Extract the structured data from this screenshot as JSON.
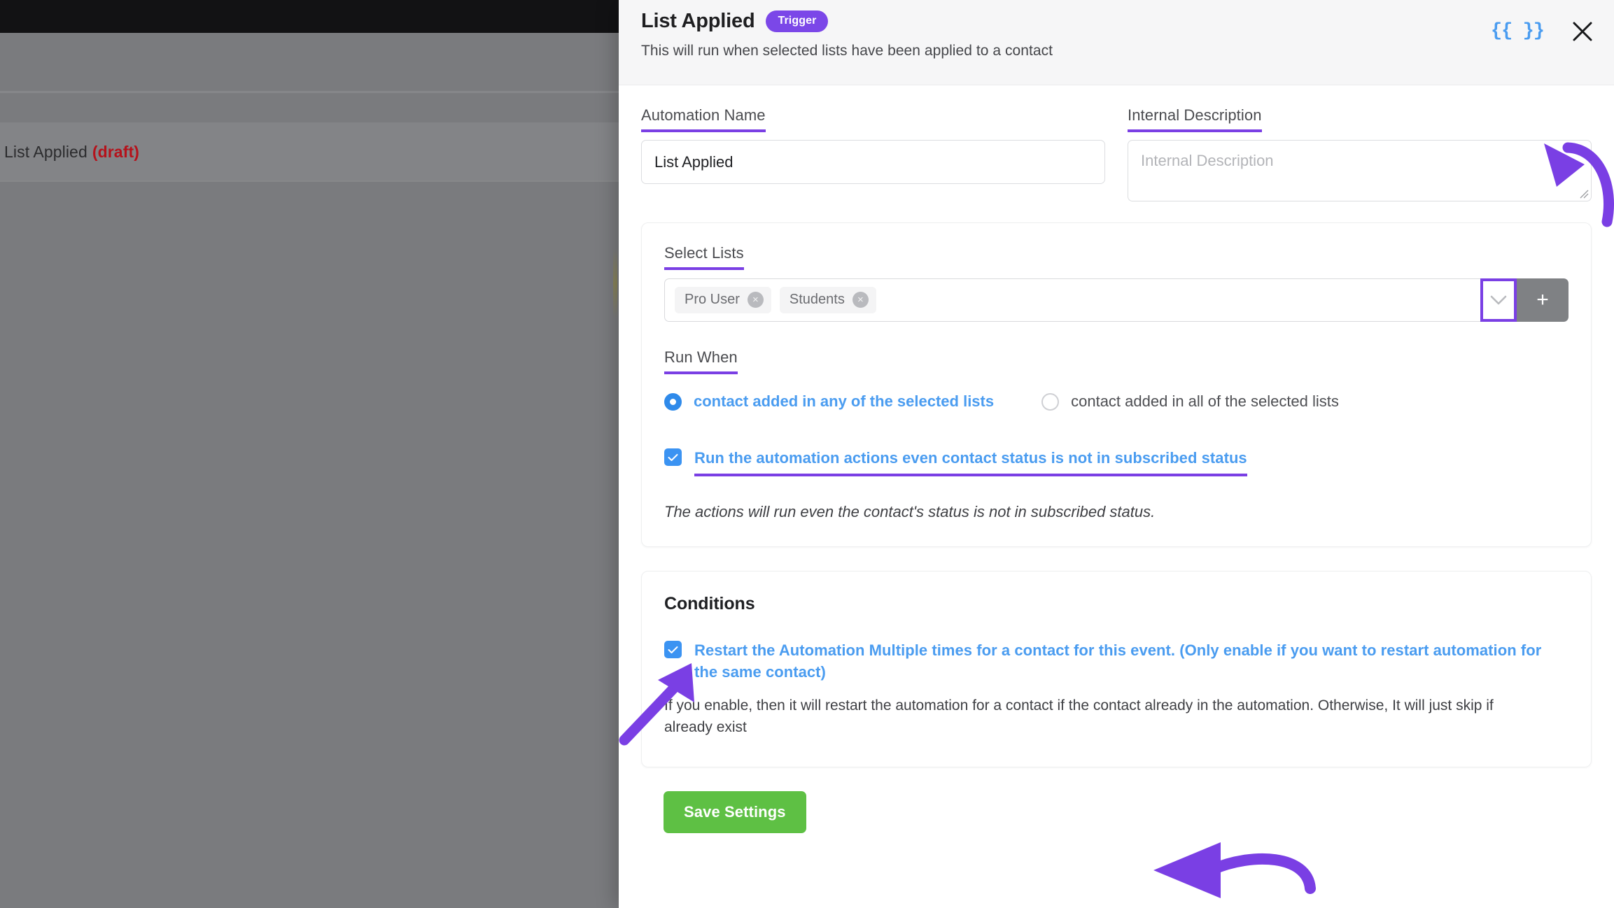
{
  "background": {
    "automation_title": "List Applied",
    "draft_label": "(draft)"
  },
  "header": {
    "title": "List Applied",
    "badge": "Trigger",
    "subtitle": "This will run when selected lists have been applied to a contact",
    "curly_icon": "{{ }}",
    "close_icon": "close-icon"
  },
  "fields": {
    "automation_name": {
      "label": "Automation Name",
      "value": "List Applied"
    },
    "internal_description": {
      "label": "Internal Description",
      "value": "",
      "placeholder": "Internal Description"
    }
  },
  "select_lists": {
    "label": "Select Lists",
    "tags": [
      {
        "label": "Pro User",
        "remove": "×"
      },
      {
        "label": "Students",
        "remove": "×"
      }
    ],
    "add_button": "+",
    "dropdown_icon": "chevron-down-icon"
  },
  "run_when": {
    "label": "Run When",
    "options": [
      {
        "label": "contact added in any of the selected lists",
        "selected": true
      },
      {
        "label": "contact added in all of the selected lists",
        "selected": false
      }
    ]
  },
  "subscribed": {
    "checkbox_label": "Run the automation actions even contact status is not in subscribed status",
    "checked": true,
    "note": "The actions will run even the contact's status is not in subscribed status."
  },
  "conditions": {
    "title": "Conditions",
    "restart": {
      "checkbox_label": "Restart the Automation Multiple times for a contact for this event. (Only enable if you want to restart automation for the same contact)",
      "checked": true,
      "note": "If you enable, then it will restart the automation for a contact if the contact already in the automation. Otherwise, It will just skip if already exist"
    }
  },
  "footer": {
    "save_label": "Save Settings"
  },
  "colors": {
    "accent_purple": "#7a3fe4",
    "badge_purple": "#7b47e8",
    "link_blue": "#4a9cf0",
    "checkbox_blue": "#3b93f2",
    "save_green": "#5ec044",
    "draft_red": "#b5121b",
    "add_button_gray": "#7f8184"
  }
}
